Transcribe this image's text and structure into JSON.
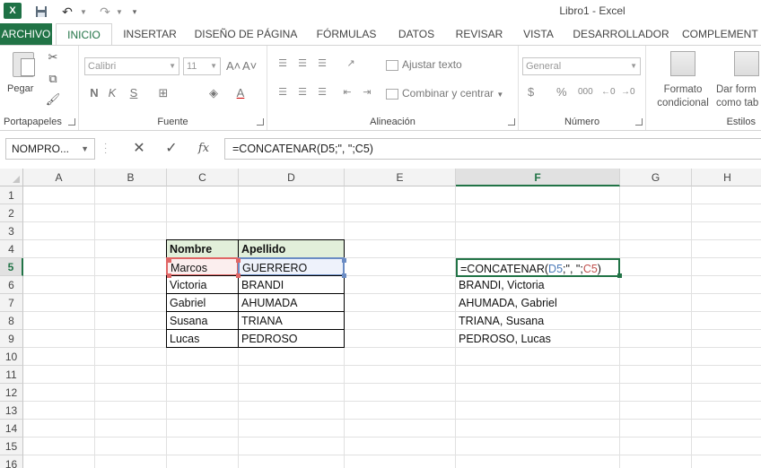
{
  "titlebar": {
    "logo": "X",
    "title": "Libro1 - Excel",
    "save_icon": "save-icon",
    "undo_icon": "undo-icon",
    "redo_icon": "redo-icon"
  },
  "tabs": [
    {
      "id": "archivo",
      "label": "ARCHIVO"
    },
    {
      "id": "inicio",
      "label": "INICIO"
    },
    {
      "id": "insertar",
      "label": "INSERTAR"
    },
    {
      "id": "diseno",
      "label": "DISEÑO DE PÁGINA"
    },
    {
      "id": "formulas",
      "label": "FÓRMULAS"
    },
    {
      "id": "datos",
      "label": "DATOS"
    },
    {
      "id": "revisar",
      "label": "REVISAR"
    },
    {
      "id": "vista",
      "label": "VISTA"
    },
    {
      "id": "desarrollador",
      "label": "DESARROLLADOR"
    },
    {
      "id": "complementos",
      "label": "COMPLEMENT"
    }
  ],
  "ribbon": {
    "portapapeles": {
      "label": "Portapapeles",
      "paste": "Pegar"
    },
    "fuente": {
      "label": "Fuente",
      "font_name": "Calibri",
      "font_size": "11",
      "grow": "A˄",
      "shrink": "A˅",
      "bold": "N",
      "italic": "K",
      "underline": "S"
    },
    "alineacion": {
      "label": "Alineación",
      "wrap_text": "Ajustar texto",
      "merge_center": "Combinar y centrar"
    },
    "numero": {
      "label": "Número",
      "format": "General",
      "currency": "$",
      "percent": "%",
      "thousands": "000"
    },
    "estilos": {
      "label": "Estilos",
      "cond_format_1": "Formato",
      "cond_format_2": "condicional",
      "table_format_1": "Dar form",
      "table_format_2": "como tab"
    }
  },
  "formula_bar": {
    "name_box": "NOMPRO...",
    "cancel": "✕",
    "enter": "✓",
    "fx": "fx",
    "formula": "=CONCATENAR(D5;\", \";C5)"
  },
  "columns": [
    "A",
    "B",
    "C",
    "D",
    "E",
    "F",
    "G",
    "H"
  ],
  "rows": [
    "1",
    "2",
    "3",
    "4",
    "5",
    "6",
    "7",
    "8",
    "9",
    "10",
    "11",
    "12",
    "13",
    "14",
    "15",
    "16"
  ],
  "table": {
    "headers": [
      "Nombre",
      "Apellido"
    ],
    "rows": [
      [
        "Marcos",
        "GUERRERO"
      ],
      [
        "Victoria",
        "BRANDI"
      ],
      [
        "Gabriel",
        "AHUMADA"
      ],
      [
        "Susana",
        "TRIANA"
      ],
      [
        "Lucas",
        "PEDROSO"
      ]
    ]
  },
  "active_cell": {
    "prefix": "=CONCATENAR(",
    "ref1": "D5",
    "middle": ";\", \";",
    "ref2": "C5",
    "suffix": ")"
  },
  "results": [
    "BRANDI, Victoria",
    "AHUMADA, Gabriel",
    "TRIANA, Susana",
    "PEDROSO, Lucas"
  ],
  "colors": {
    "accent": "#217346",
    "header_fill": "#e2efda",
    "ref_blue": "#4a7ab8",
    "ref_red": "#c0504d"
  }
}
